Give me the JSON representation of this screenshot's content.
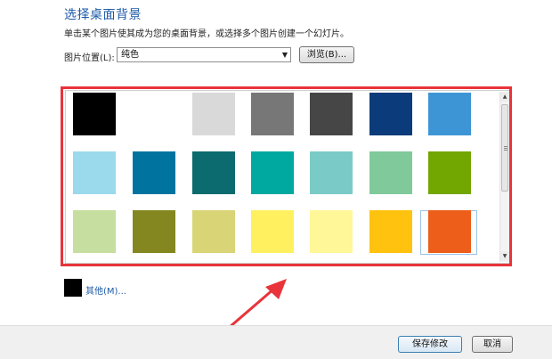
{
  "header": {
    "title": "选择桌面背景",
    "description": "单击某个图片使其成为您的桌面背景，或选择多个图片创建一个幻灯片。"
  },
  "location": {
    "label": "图片位置(L):",
    "selected": "纯色",
    "browse_label": "浏览(B)..."
  },
  "colors": {
    "row1": [
      "#000000",
      "#ffffff",
      "#d9d9d9",
      "#777777",
      "#464646",
      "#0b3b7a",
      "#3e95d6"
    ],
    "row2": [
      "#9bd9ec",
      "#00749f",
      "#0b6b6e",
      "#00a9a0",
      "#7acbc7",
      "#80c99a",
      "#72a600"
    ],
    "row3": [
      "#c6de9f",
      "#848720",
      "#d9d576",
      "#fff060",
      "#fff798",
      "#ffc20e",
      "#ec5e1a"
    ],
    "selected_color": "#ec5e1a",
    "highlight": "#e8343a"
  },
  "other": {
    "label": "其他(M)...",
    "swatch_color": "#000000"
  },
  "footer": {
    "save_label": "保存修改",
    "cancel_label": "取消"
  }
}
